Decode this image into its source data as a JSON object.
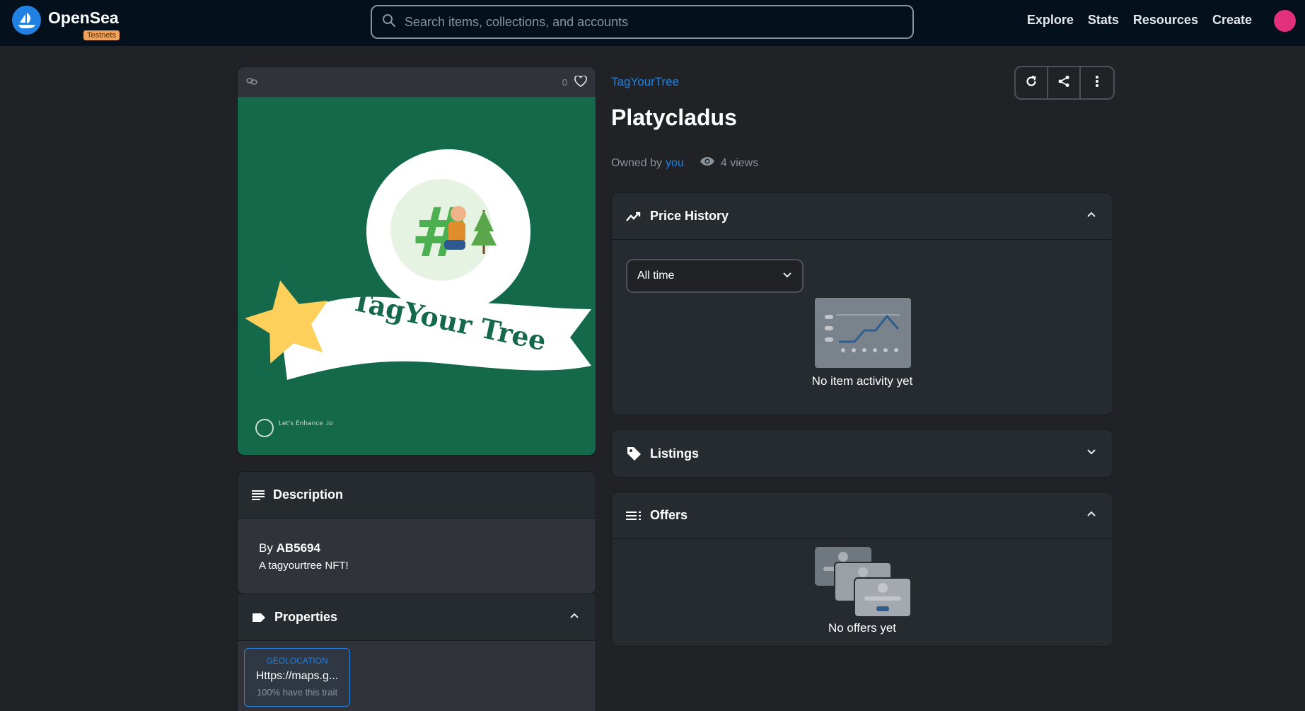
{
  "header": {
    "brand": "OpenSea",
    "badge": "Testnets",
    "search_placeholder": "Search items, collections, and accounts",
    "nav": [
      "Explore",
      "Stats",
      "Resources",
      "Create"
    ]
  },
  "media": {
    "like_count": "0",
    "artwork_text": "TagYour Tree",
    "watermark": "Let's Enhance .io"
  },
  "description": {
    "title": "Description",
    "by_label": "By",
    "creator": "AB5694",
    "text": "A tagyourtree NFT!"
  },
  "properties": {
    "title": "Properties",
    "items": [
      {
        "type": "GEOLOCATION",
        "value": "Https://maps.g...",
        "rarity": "100% have this trait"
      }
    ]
  },
  "item": {
    "collection": "TagYourTree",
    "title": "Platycladus",
    "owned_by_label": "Owned by",
    "owner": "you",
    "views": "4 views"
  },
  "price_history": {
    "title": "Price History",
    "filter_selected": "All time",
    "empty_text": "No item activity yet"
  },
  "listings": {
    "title": "Listings"
  },
  "offers": {
    "title": "Offers",
    "empty_text": "No offers yet"
  },
  "colors": {
    "background": "#202225",
    "topbar": "#04111d",
    "accent": "#2081e2",
    "artwork_green": "#13694a",
    "star": "#fdd05b",
    "avatar": "#e2307a"
  }
}
